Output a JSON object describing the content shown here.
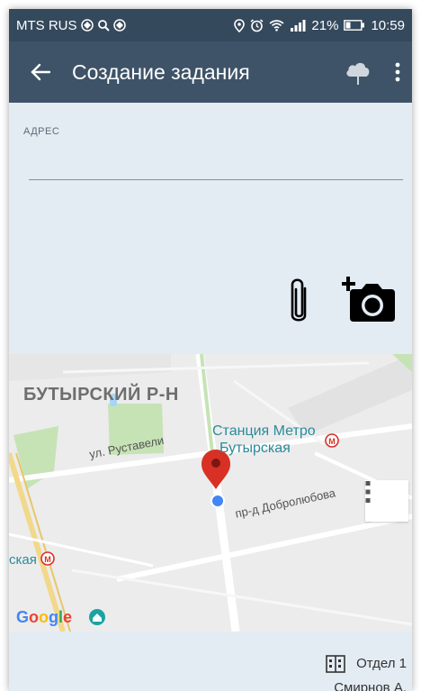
{
  "status_bar": {
    "carrier": "MTS RUS",
    "battery": "21%",
    "time": "10:59",
    "icons": [
      "vpn-icon",
      "search-icon",
      "vpn-icon",
      "location-icon",
      "alarm-icon",
      "wifi-icon",
      "signal-icon",
      "battery-icon"
    ]
  },
  "app_bar": {
    "title": "Создание задания",
    "icons": [
      "back-arrow-icon",
      "cloud-upload-icon",
      "more-vert-icon"
    ]
  },
  "form": {
    "address_label": "АДРЕС",
    "address_value": "",
    "icons": [
      "paperclip-icon",
      "add-photo-icon"
    ]
  },
  "map": {
    "district": "БУТЫРСКИЙ Р-Н",
    "metro_line1": "Станция Метро",
    "metro_line2": "Бутырская",
    "street1": "ул. Руставели",
    "street2": "пр-д Добролюбова",
    "left_station": "ская",
    "google_letters": [
      "G",
      "o",
      "o",
      "g",
      "l",
      "e"
    ],
    "google_colors": [
      "#4285F4",
      "#EA4335",
      "#FBBC05",
      "#4285F4",
      "#34A853",
      "#EA4335"
    ],
    "marker_color": "#d93025",
    "location_dot_color": "#4285f4",
    "metro_color": "#d93025"
  },
  "footer": {
    "department": "Отдел 1",
    "person": "Смирнов А."
  },
  "colors": {
    "status_bar": "#35495d",
    "app_bar": "#3e5368",
    "background": "#e3ebf3"
  }
}
